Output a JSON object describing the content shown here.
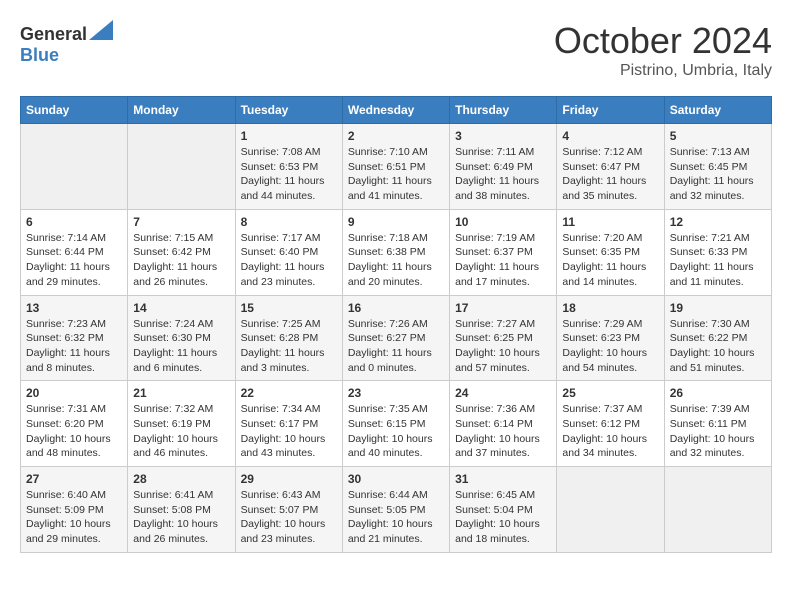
{
  "header": {
    "logo_general": "General",
    "logo_blue": "Blue",
    "month": "October 2024",
    "location": "Pistrino, Umbria, Italy"
  },
  "days_of_week": [
    "Sunday",
    "Monday",
    "Tuesday",
    "Wednesday",
    "Thursday",
    "Friday",
    "Saturday"
  ],
  "weeks": [
    [
      {
        "day": "",
        "info": ""
      },
      {
        "day": "",
        "info": ""
      },
      {
        "day": "1",
        "info": "Sunrise: 7:08 AM\nSunset: 6:53 PM\nDaylight: 11 hours and 44 minutes."
      },
      {
        "day": "2",
        "info": "Sunrise: 7:10 AM\nSunset: 6:51 PM\nDaylight: 11 hours and 41 minutes."
      },
      {
        "day": "3",
        "info": "Sunrise: 7:11 AM\nSunset: 6:49 PM\nDaylight: 11 hours and 38 minutes."
      },
      {
        "day": "4",
        "info": "Sunrise: 7:12 AM\nSunset: 6:47 PM\nDaylight: 11 hours and 35 minutes."
      },
      {
        "day": "5",
        "info": "Sunrise: 7:13 AM\nSunset: 6:45 PM\nDaylight: 11 hours and 32 minutes."
      }
    ],
    [
      {
        "day": "6",
        "info": "Sunrise: 7:14 AM\nSunset: 6:44 PM\nDaylight: 11 hours and 29 minutes."
      },
      {
        "day": "7",
        "info": "Sunrise: 7:15 AM\nSunset: 6:42 PM\nDaylight: 11 hours and 26 minutes."
      },
      {
        "day": "8",
        "info": "Sunrise: 7:17 AM\nSunset: 6:40 PM\nDaylight: 11 hours and 23 minutes."
      },
      {
        "day": "9",
        "info": "Sunrise: 7:18 AM\nSunset: 6:38 PM\nDaylight: 11 hours and 20 minutes."
      },
      {
        "day": "10",
        "info": "Sunrise: 7:19 AM\nSunset: 6:37 PM\nDaylight: 11 hours and 17 minutes."
      },
      {
        "day": "11",
        "info": "Sunrise: 7:20 AM\nSunset: 6:35 PM\nDaylight: 11 hours and 14 minutes."
      },
      {
        "day": "12",
        "info": "Sunrise: 7:21 AM\nSunset: 6:33 PM\nDaylight: 11 hours and 11 minutes."
      }
    ],
    [
      {
        "day": "13",
        "info": "Sunrise: 7:23 AM\nSunset: 6:32 PM\nDaylight: 11 hours and 8 minutes."
      },
      {
        "day": "14",
        "info": "Sunrise: 7:24 AM\nSunset: 6:30 PM\nDaylight: 11 hours and 6 minutes."
      },
      {
        "day": "15",
        "info": "Sunrise: 7:25 AM\nSunset: 6:28 PM\nDaylight: 11 hours and 3 minutes."
      },
      {
        "day": "16",
        "info": "Sunrise: 7:26 AM\nSunset: 6:27 PM\nDaylight: 11 hours and 0 minutes."
      },
      {
        "day": "17",
        "info": "Sunrise: 7:27 AM\nSunset: 6:25 PM\nDaylight: 10 hours and 57 minutes."
      },
      {
        "day": "18",
        "info": "Sunrise: 7:29 AM\nSunset: 6:23 PM\nDaylight: 10 hours and 54 minutes."
      },
      {
        "day": "19",
        "info": "Sunrise: 7:30 AM\nSunset: 6:22 PM\nDaylight: 10 hours and 51 minutes."
      }
    ],
    [
      {
        "day": "20",
        "info": "Sunrise: 7:31 AM\nSunset: 6:20 PM\nDaylight: 10 hours and 48 minutes."
      },
      {
        "day": "21",
        "info": "Sunrise: 7:32 AM\nSunset: 6:19 PM\nDaylight: 10 hours and 46 minutes."
      },
      {
        "day": "22",
        "info": "Sunrise: 7:34 AM\nSunset: 6:17 PM\nDaylight: 10 hours and 43 minutes."
      },
      {
        "day": "23",
        "info": "Sunrise: 7:35 AM\nSunset: 6:15 PM\nDaylight: 10 hours and 40 minutes."
      },
      {
        "day": "24",
        "info": "Sunrise: 7:36 AM\nSunset: 6:14 PM\nDaylight: 10 hours and 37 minutes."
      },
      {
        "day": "25",
        "info": "Sunrise: 7:37 AM\nSunset: 6:12 PM\nDaylight: 10 hours and 34 minutes."
      },
      {
        "day": "26",
        "info": "Sunrise: 7:39 AM\nSunset: 6:11 PM\nDaylight: 10 hours and 32 minutes."
      }
    ],
    [
      {
        "day": "27",
        "info": "Sunrise: 6:40 AM\nSunset: 5:09 PM\nDaylight: 10 hours and 29 minutes."
      },
      {
        "day": "28",
        "info": "Sunrise: 6:41 AM\nSunset: 5:08 PM\nDaylight: 10 hours and 26 minutes."
      },
      {
        "day": "29",
        "info": "Sunrise: 6:43 AM\nSunset: 5:07 PM\nDaylight: 10 hours and 23 minutes."
      },
      {
        "day": "30",
        "info": "Sunrise: 6:44 AM\nSunset: 5:05 PM\nDaylight: 10 hours and 21 minutes."
      },
      {
        "day": "31",
        "info": "Sunrise: 6:45 AM\nSunset: 5:04 PM\nDaylight: 10 hours and 18 minutes."
      },
      {
        "day": "",
        "info": ""
      },
      {
        "day": "",
        "info": ""
      }
    ]
  ]
}
